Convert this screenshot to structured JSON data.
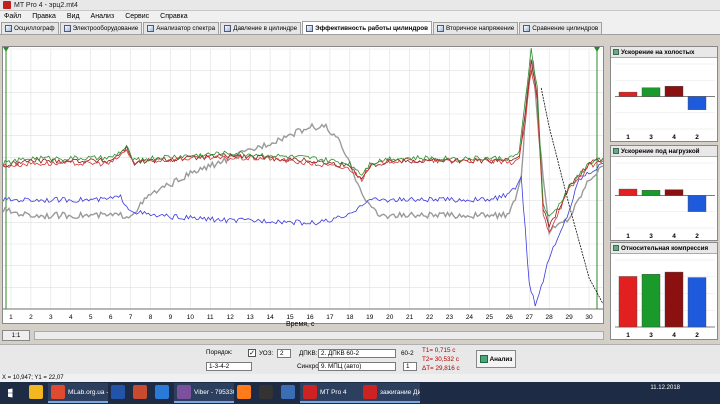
{
  "window": {
    "title": "MT Pro 4 - эрц2.mt4"
  },
  "menu": [
    "Файл",
    "Правка",
    "Вид",
    "Анализ",
    "Сервис",
    "Справка"
  ],
  "tabs": [
    {
      "label": "Осциллограф",
      "active": false
    },
    {
      "label": "Электрооборудование",
      "active": false
    },
    {
      "label": "Анализатор спектра",
      "active": false
    },
    {
      "label": "Давление в цилиндре",
      "active": false
    },
    {
      "label": "Эффективность работы цилиндров",
      "active": true
    },
    {
      "label": "Вторичное напряжение",
      "active": false
    },
    {
      "label": "Сравнение цилиндров",
      "active": false
    }
  ],
  "main_chart": {
    "xlabel": "Время, с",
    "x_ticks": [
      "1",
      "2",
      "3",
      "4",
      "5",
      "6",
      "7",
      "8",
      "9",
      "10",
      "11",
      "12",
      "13",
      "14",
      "15",
      "16",
      "17",
      "18",
      "19",
      "20",
      "21",
      "22",
      "23",
      "24",
      "25",
      "26",
      "27",
      "28",
      "29",
      "30"
    ],
    "xlim": [
      0.6,
      30.7
    ],
    "colors": {
      "green": "#2e8b2e",
      "red": "#d83030",
      "dark_red": "#8b1a1a",
      "gray": "#9a9a9a",
      "blue": "#3a3adf",
      "black": "#111111"
    }
  },
  "panels": [
    {
      "title": "Ускорение на холостых",
      "categories": [
        "1",
        "3",
        "4",
        "2"
      ],
      "values": [
        0.15,
        0.3,
        0.35,
        -0.45
      ],
      "colors": [
        "#e32020",
        "#1a9a2a",
        "#8b1010",
        "#1e5bdc"
      ]
    },
    {
      "title": "Ускорение под нагрузкой",
      "categories": [
        "1",
        "3",
        "4",
        "2"
      ],
      "values": [
        0.22,
        0.18,
        0.2,
        -0.55
      ],
      "colors": [
        "#e32020",
        "#1a9a2a",
        "#8b1010",
        "#1e5bdc"
      ]
    },
    {
      "title": "Относительная компрессия",
      "categories": [
        "1",
        "3",
        "4",
        "2"
      ],
      "values": [
        0.92,
        0.96,
        1.0,
        0.9
      ],
      "colors": [
        "#e32020",
        "#1a9a2a",
        "#8b1010",
        "#1e5bdc"
      ]
    }
  ],
  "chart_data": [
    {
      "type": "line",
      "xlabel": "Время, с",
      "xlim": [
        0.6,
        30.7
      ],
      "series": [
        {
          "color": "green",
          "x": [
            0.6,
            2,
            4,
            6,
            6.8,
            7.2,
            8,
            10,
            12,
            14,
            16,
            17,
            18,
            18.6,
            19,
            20,
            22,
            24,
            25,
            26,
            26.5,
            26.8,
            27.1,
            27.4,
            27.7,
            28,
            28.5,
            29,
            30,
            30.7
          ],
          "y": [
            0.56,
            0.58,
            0.58,
            0.58,
            0.62,
            0.57,
            0.58,
            0.59,
            0.6,
            0.59,
            0.58,
            0.57,
            0.56,
            0.52,
            0.56,
            0.58,
            0.58,
            0.58,
            0.58,
            0.58,
            0.6,
            0.8,
            1.0,
            0.85,
            0.4,
            0.35,
            0.4,
            0.47,
            0.56,
            0.58
          ]
        },
        {
          "color": "red",
          "x": [
            0.6,
            2,
            4,
            6,
            6.8,
            7.2,
            8,
            10,
            12,
            14,
            16,
            17,
            18,
            18.6,
            19,
            20,
            22,
            24,
            25,
            26,
            26.5,
            26.8,
            27.1,
            27.4,
            27.7,
            28,
            28.5,
            29,
            30,
            30.7
          ],
          "y": [
            0.55,
            0.56,
            0.56,
            0.56,
            0.61,
            0.56,
            0.57,
            0.58,
            0.58,
            0.58,
            0.56,
            0.55,
            0.54,
            0.5,
            0.55,
            0.57,
            0.57,
            0.57,
            0.57,
            0.56,
            0.58,
            0.72,
            0.92,
            0.8,
            0.36,
            0.3,
            0.38,
            0.46,
            0.55,
            0.57
          ]
        },
        {
          "color": "dark_red",
          "x": [
            0.6,
            2,
            4,
            6,
            6.8,
            7.2,
            8,
            10,
            12,
            14,
            16,
            17,
            18,
            18.6,
            19,
            20,
            22,
            24,
            25,
            26,
            26.5,
            26.8,
            27.1,
            27.4,
            27.7,
            28,
            28.5,
            29,
            30,
            30.7
          ],
          "y": [
            0.55,
            0.57,
            0.57,
            0.57,
            0.62,
            0.56,
            0.57,
            0.58,
            0.59,
            0.58,
            0.57,
            0.56,
            0.55,
            0.5,
            0.55,
            0.57,
            0.57,
            0.57,
            0.57,
            0.57,
            0.59,
            0.76,
            0.96,
            0.82,
            0.38,
            0.32,
            0.39,
            0.47,
            0.56,
            0.58
          ]
        },
        {
          "color": "gray",
          "x": [
            0.6,
            2,
            4,
            6,
            7,
            8,
            10,
            12,
            14,
            15,
            16,
            16.8,
            17.5,
            18.2,
            18.8,
            19.4,
            20,
            22,
            24,
            26,
            26.6,
            26.9,
            27.2,
            27.5,
            28,
            29,
            30,
            30.7
          ],
          "y": [
            0.38,
            0.36,
            0.36,
            0.36,
            0.36,
            0.44,
            0.52,
            0.58,
            0.64,
            0.67,
            0.7,
            0.7,
            0.64,
            0.52,
            0.42,
            0.36,
            0.36,
            0.36,
            0.36,
            0.36,
            0.5,
            0.85,
            0.95,
            0.65,
            0.3,
            0.35,
            0.5,
            0.55
          ]
        },
        {
          "color": "blue",
          "x": [
            0.6,
            2,
            4,
            5.5,
            6.5,
            7,
            8,
            10,
            12,
            14,
            16,
            17,
            18,
            18.5,
            19,
            20,
            22,
            24,
            25,
            26,
            26.6,
            27,
            27.3,
            27.6,
            28,
            28.5,
            29,
            29.5,
            30.7
          ],
          "y": [
            0.42,
            0.42,
            0.42,
            0.42,
            0.43,
            0.38,
            0.36,
            0.35,
            0.34,
            0.34,
            0.33,
            0.34,
            0.36,
            0.4,
            0.42,
            0.42,
            0.42,
            0.42,
            0.42,
            0.44,
            0.5,
            0.1,
            0.02,
            0.08,
            0.2,
            0.28,
            0.38,
            0.5,
            0.56
          ]
        },
        {
          "color": "black",
          "x": [
            27.6,
            28,
            29,
            30,
            30.7
          ],
          "y": [
            0.85,
            0.7,
            0.4,
            0.12,
            0.02
          ]
        }
      ]
    }
  ],
  "bottom": {
    "zoom_label": "1:1",
    "order_label": "Порядок:",
    "order_value": "1-3-4-2",
    "uoz_label": "УОЗ:",
    "uoz_value": "2",
    "dpkv_label": "ДПКВ:",
    "dpkv_value": "2. ДПКВ 60-2",
    "dpkv_type": "60-2",
    "sync_label": "Синхро:",
    "sync_value": "9. МПЦ (авто)",
    "sync_num": "1",
    "t1": "T1= 0,715 с",
    "t2": "T2= 30,532 с",
    "dt": "ΔT= 29,816 с",
    "analyze_label": "Анализ"
  },
  "status": {
    "text": "X = 10,947; Y1 = 22,07"
  },
  "taskbar": {
    "items": [
      {
        "label": "",
        "icon_color": "#f3b720",
        "open": false
      },
      {
        "label": "MLab.org.ua - От...",
        "icon_color": "#e04a2f",
        "open": true
      },
      {
        "label": "",
        "icon_color": "#2255aa",
        "open": false
      },
      {
        "label": "",
        "icon_color": "#c84b2f",
        "open": false
      },
      {
        "label": "",
        "icon_color": "#2a7ad8",
        "open": false
      },
      {
        "label": "Viber - 79533062...",
        "icon_color": "#7b519d",
        "open": true
      },
      {
        "label": "",
        "icon_color": "#ff7a18",
        "open": false
      },
      {
        "label": "",
        "icon_color": "#333333",
        "open": false
      },
      {
        "label": "",
        "icon_color": "#3b6db5",
        "open": false
      },
      {
        "label": "MT Pro 4",
        "icon_color": "#cc2222",
        "open": true
      },
      {
        "label": "зажигание ДИС ...",
        "icon_color": "#cc2222",
        "open": true
      }
    ],
    "date": "11.12.2018"
  }
}
